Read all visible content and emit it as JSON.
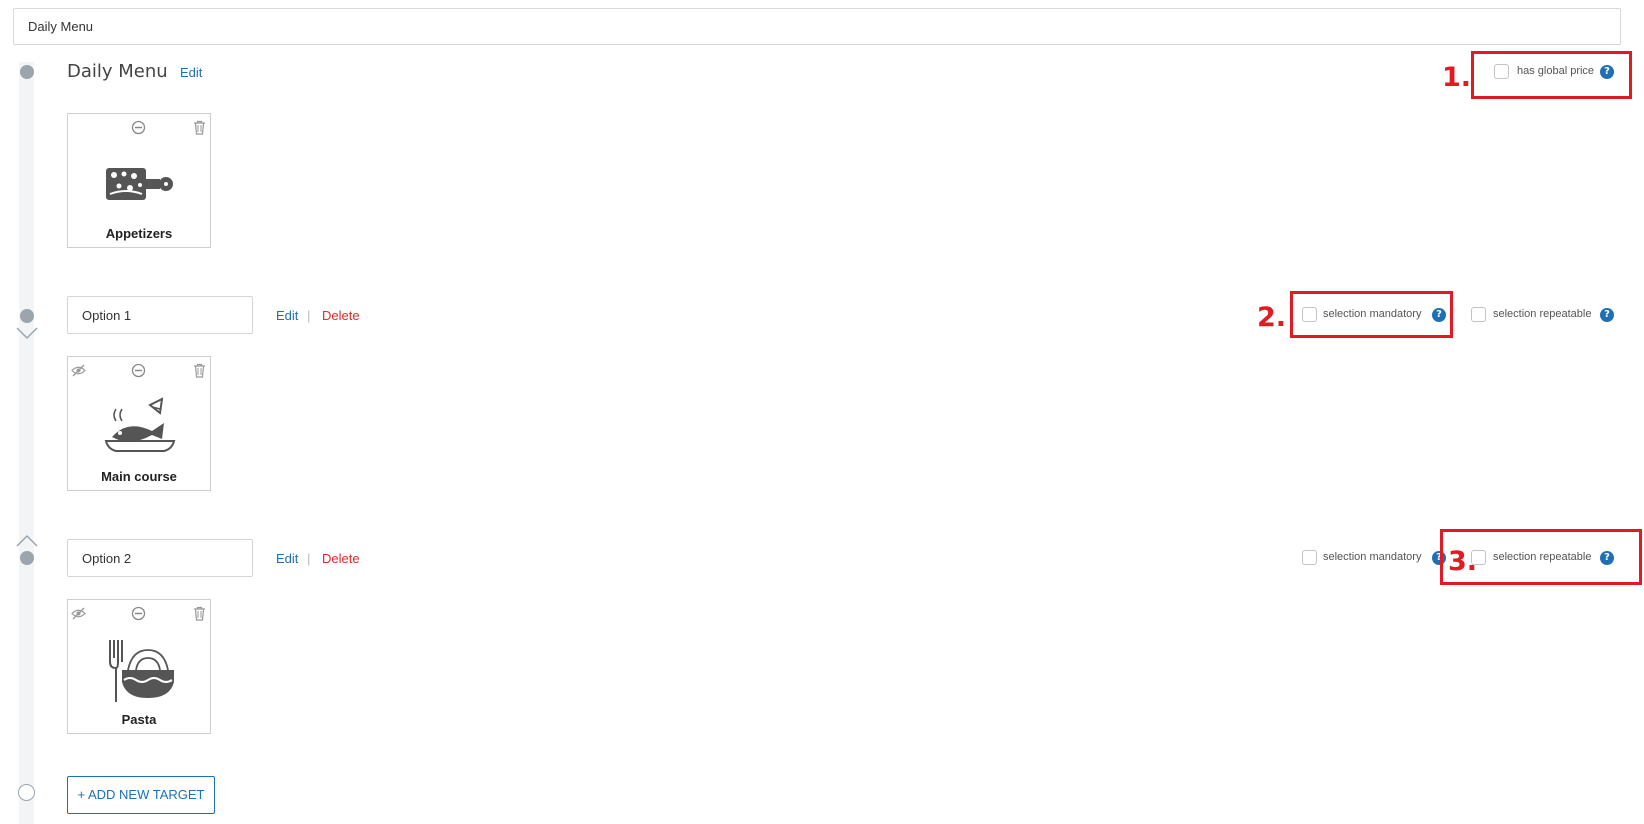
{
  "menu_name_value": "Daily Menu",
  "menu": {
    "title": "Daily Menu",
    "edit_label": "Edit",
    "global_price_label": "has global price",
    "help_glyph": "?"
  },
  "options": [
    {
      "value": "Option 1",
      "edit_label": "Edit",
      "delete_label": "Delete",
      "mandatory_label": "selection mandatory",
      "repeatable_label": "selection repeatable"
    },
    {
      "value": "Option 2",
      "edit_label": "Edit",
      "delete_label": "Delete",
      "mandatory_label": "selection mandatory",
      "repeatable_label": "selection repeatable"
    }
  ],
  "cards": [
    {
      "label": "Appetizers",
      "icon": "cutting-board-icon"
    },
    {
      "label": "Main course",
      "icon": "fish-dish-icon"
    },
    {
      "label": "Pasta",
      "icon": "pasta-bowl-icon"
    }
  ],
  "annotations": [
    "1.",
    "2.",
    "3."
  ],
  "add_target_label": "+ ADD NEW TARGET",
  "colors": {
    "accent": "#1f6fb5",
    "danger": "#e02a2a",
    "annotation": "#e21b23",
    "rail": "#f2f4f6",
    "dot": "#9aa5ae"
  }
}
